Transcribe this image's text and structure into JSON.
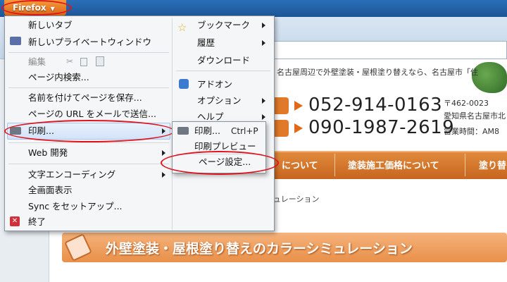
{
  "app": {
    "button_label": "Firefox"
  },
  "main_menu": {
    "items": [
      {
        "label": "新しいタブ"
      },
      {
        "label": "新しいプライベートウィンドウ"
      },
      {
        "label": "編集"
      },
      {
        "label": "ページ内検索..."
      },
      {
        "label": "名前を付けてページを保存..."
      },
      {
        "label": "ページの URL をメールで送信..."
      },
      {
        "label": "印刷..."
      },
      {
        "label": "Web 開発"
      },
      {
        "label": "文字エンコーディング"
      },
      {
        "label": "全画面表示"
      },
      {
        "label": "Sync をセットアップ..."
      },
      {
        "label": "終了"
      }
    ]
  },
  "right_menu": {
    "items": [
      {
        "label": "ブックマーク"
      },
      {
        "label": "履歴"
      },
      {
        "label": "ダウンロード"
      },
      {
        "label": "アドオン"
      },
      {
        "label": "オプション"
      },
      {
        "label": "ヘルプ"
      }
    ]
  },
  "print_submenu": {
    "items": [
      {
        "label": "印刷...",
        "shortcut": "Ctrl+P"
      },
      {
        "label": "印刷プレビュー"
      },
      {
        "label": "ページ設定..."
      }
    ]
  },
  "webpage": {
    "top_note": "・名古屋周辺で外壁塗装・屋根塗り替えなら、名古屋市「住",
    "tel1": "052-914-0163",
    "tel2": "090-1987-2619",
    "zip": "〒462-0023",
    "address": "愛知県名古屋市北",
    "hours": "営業時間：AM8",
    "nav": [
      "について",
      "塗装施工価格について",
      "塗り替"
    ],
    "breadcrumb": "ュレーション",
    "banner": "外壁塗装・屋根塗り替えのカラーシミュレーション"
  },
  "colors": {
    "highlight_oval": "#e0141e",
    "firefox_button": "#e07a2a",
    "nav_orange": "#d7772c"
  }
}
